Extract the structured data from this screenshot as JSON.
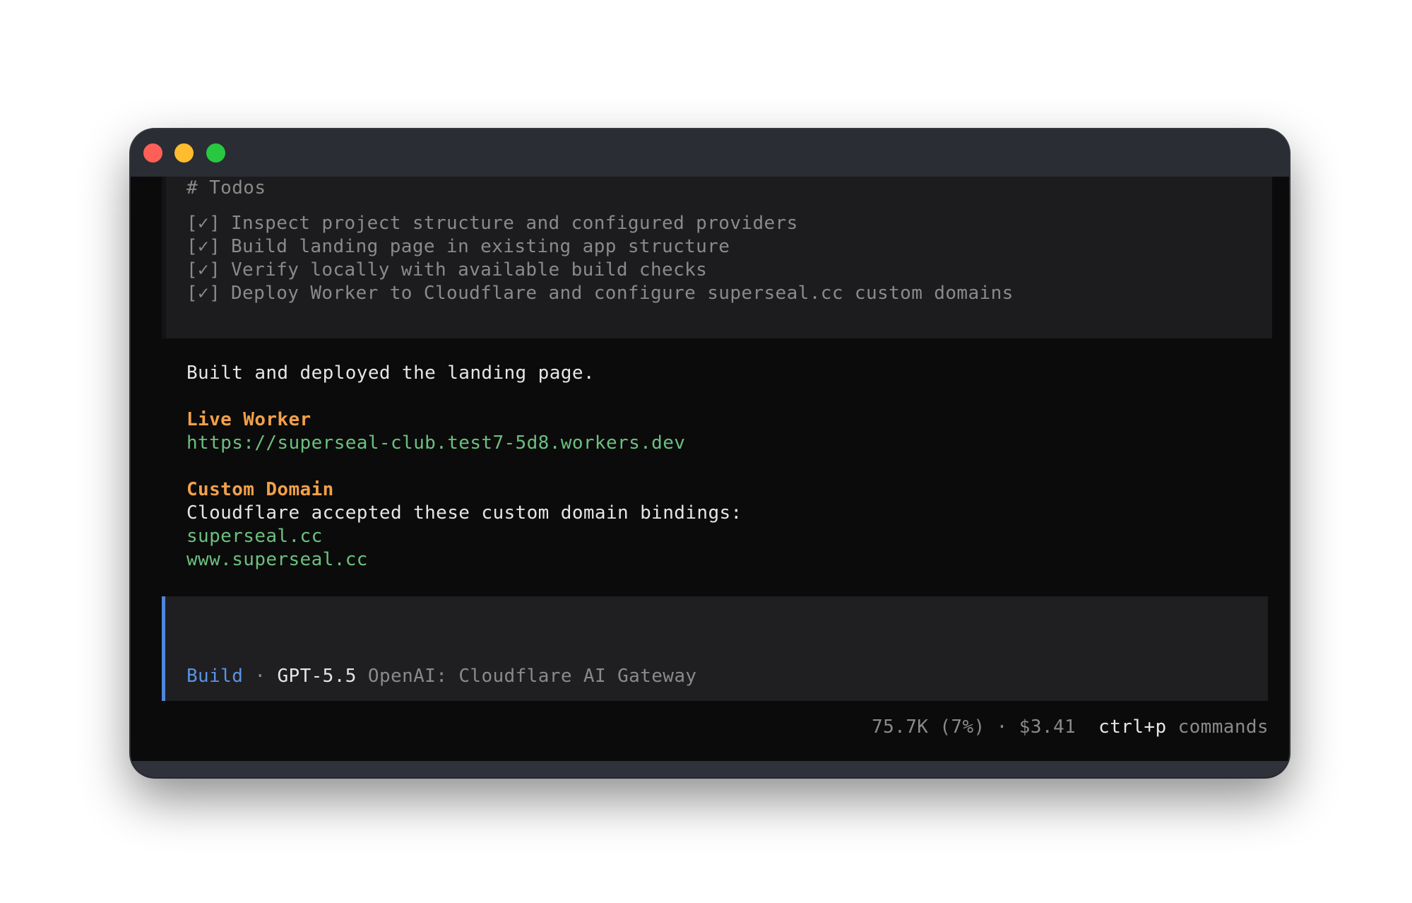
{
  "todos": {
    "heading": "# Todos",
    "items": [
      {
        "check": "[✓]",
        "text": "Inspect project structure and configured providers"
      },
      {
        "check": "[✓]",
        "text": "Build landing page in existing app structure"
      },
      {
        "check": "[✓]",
        "text": "Verify locally with available build checks"
      },
      {
        "check": "[✓]",
        "text": "Deploy Worker to Cloudflare and configure superseal.cc custom domains"
      }
    ]
  },
  "message": {
    "summary": "Built and deployed the landing page.",
    "live_worker_heading": "Live Worker",
    "live_worker_url": "https://superseal-club.test7-5d8.workers.dev",
    "custom_domain_heading": "Custom Domain",
    "custom_domain_text": "Cloudflare accepted these custom domain bindings:",
    "domains": [
      "superseal.cc",
      "www.superseal.cc"
    ]
  },
  "input": {
    "mode": "Build",
    "separator": "·",
    "model": "GPT-5.5",
    "provider": "OpenAI: Cloudflare AI Gateway"
  },
  "status": {
    "tokens": "75.7K (7%)",
    "separator": "·",
    "cost": "$3.41",
    "shortcut": "ctrl+p",
    "shortcut_label": "commands"
  },
  "colors": {
    "accent_blue": "#5b92e5",
    "heading_orange": "#f2a04a",
    "link_green": "#6cc07e",
    "traffic_red": "#fe5f57",
    "traffic_yellow": "#febc2e",
    "traffic_green": "#28c840"
  }
}
